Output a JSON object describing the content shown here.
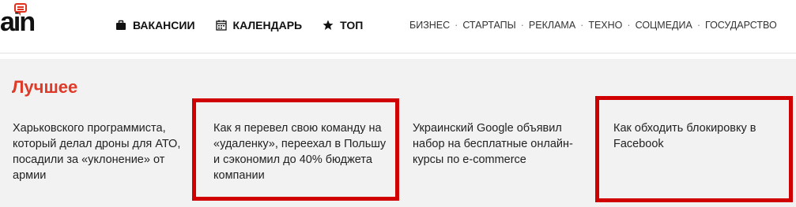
{
  "header": {
    "logo_text": "ain",
    "main_nav": [
      {
        "label": "ВАКАНСИИ",
        "icon": "briefcase-icon"
      },
      {
        "label": "КАЛЕНДАРЬ",
        "icon": "calendar-icon"
      },
      {
        "label": "ТОП",
        "icon": "star-icon"
      }
    ],
    "categories": [
      "БИЗНЕС",
      "СТАРТАПЫ",
      "РЕКЛАМА",
      "ТЕХНО",
      "СОЦМЕДИА",
      "ГОСУДАРСТВО"
    ],
    "separator": "·"
  },
  "best": {
    "title": "Лучшее",
    "articles": [
      {
        "title": "Харьковского программиста, который делал дроны для АТО, посадили за «уклонение» от армии"
      },
      {
        "title": "Как я перевел свою команду на «удаленку», переехал в Польшу и сэкономил до 40% бюджета компании"
      },
      {
        "title": "Украинский Google объявил набор на бесплатные онлайн-курсы по e-commerce"
      },
      {
        "title": "Как обходить блокировку в Facebook"
      }
    ]
  },
  "colors": {
    "accent": "#de3a27",
    "highlight": "#d00000",
    "section_bg": "#f2f2f2"
  }
}
